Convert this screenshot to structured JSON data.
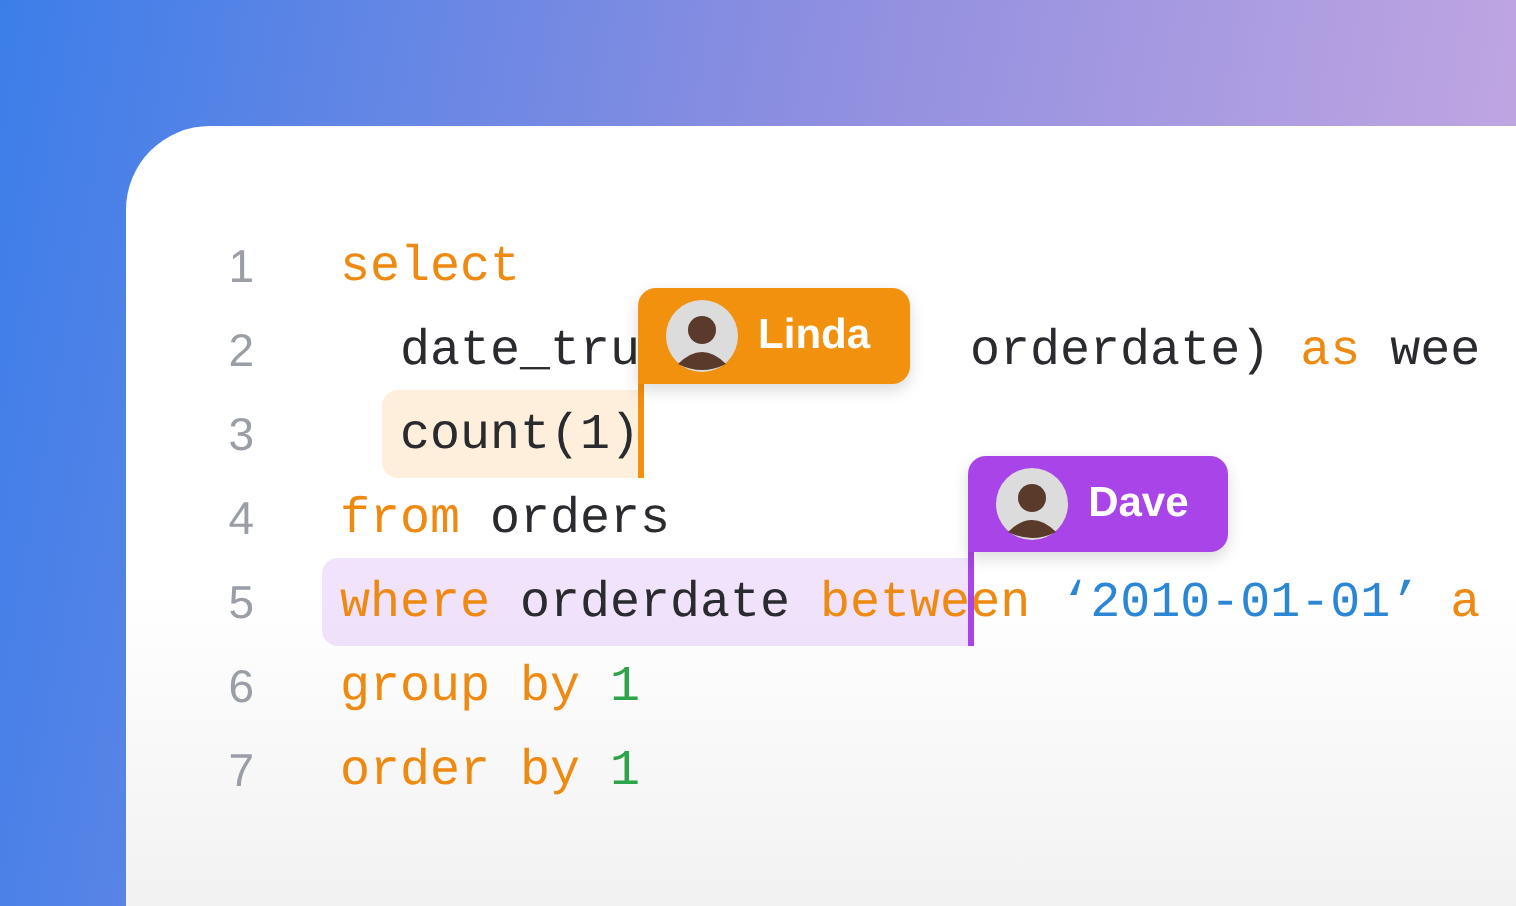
{
  "lines": [
    {
      "number": "1",
      "tokens": [
        {
          "text": "select",
          "kind": "keyword",
          "selected": false
        }
      ]
    },
    {
      "number": "2",
      "tokens": [
        {
          "text": "  date_tru",
          "kind": "plain",
          "selected": false
        },
        {
          "text": "           orderdate) ",
          "kind": "plain",
          "selected": false
        },
        {
          "text": "as ",
          "kind": "keyword",
          "selected": false
        },
        {
          "text": "wee",
          "kind": "plain",
          "selected": false
        }
      ]
    },
    {
      "number": "3",
      "tokens": [
        {
          "text": "  count(1)",
          "kind": "plain",
          "selected": true
        }
      ],
      "cursor": {
        "name": "Linda",
        "color": "#f2910d"
      }
    },
    {
      "number": "4",
      "tokens": [
        {
          "text": "from ",
          "kind": "keyword",
          "selected": false
        },
        {
          "text": "orders",
          "kind": "plain",
          "selected": false
        }
      ]
    },
    {
      "number": "5",
      "tokens": [
        {
          "text": "where ",
          "kind": "keyword",
          "selected": true
        },
        {
          "text": "orderdate ",
          "kind": "plain",
          "selected": true
        },
        {
          "text": "betwe",
          "kind": "keyword",
          "selected": true
        },
        {
          "text": "en ",
          "kind": "keyword",
          "selected": false
        },
        {
          "text": "‘2010-01-01’ ",
          "kind": "string",
          "selected": false
        },
        {
          "text": "a",
          "kind": "keyword",
          "selected": false
        }
      ],
      "cursor": {
        "name": "Dave",
        "color": "#a944e8"
      }
    },
    {
      "number": "6",
      "tokens": [
        {
          "text": "group ",
          "kind": "keyword",
          "selected": false
        },
        {
          "text": "by ",
          "kind": "keyword",
          "selected": false
        },
        {
          "text": "1",
          "kind": "number",
          "selected": false
        }
      ]
    },
    {
      "number": "7",
      "tokens": [
        {
          "text": "order ",
          "kind": "keyword",
          "selected": false
        },
        {
          "text": "by ",
          "kind": "keyword",
          "selected": false
        },
        {
          "text": "1",
          "kind": "number",
          "selected": false
        }
      ]
    }
  ]
}
